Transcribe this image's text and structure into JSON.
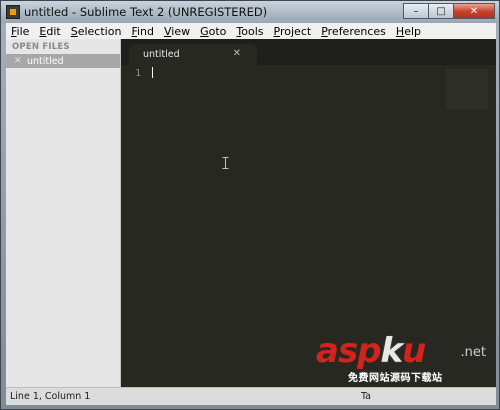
{
  "window": {
    "title": "untitled - Sublime Text 2 (UNREGISTERED)",
    "controls": [
      "–",
      "□",
      "✕"
    ]
  },
  "menu": [
    "File",
    "Edit",
    "Selection",
    "Find",
    "View",
    "Goto",
    "Tools",
    "Project",
    "Preferences",
    "Help"
  ],
  "sidebar": {
    "header": "OPEN FILES",
    "files": [
      {
        "name": "untitled",
        "close": "✕"
      }
    ]
  },
  "editor": {
    "tab": {
      "label": "untitled",
      "close": "✕"
    },
    "line_numbers": [
      "1"
    ]
  },
  "status": {
    "position": "Line 1, Column 1",
    "right": "Ta"
  },
  "watermark": {
    "main_a": "asp",
    "main_k": "k",
    "main_u": "u",
    "net": ".net",
    "sub": "免费网站源码下载站"
  },
  "colors": {
    "editor_bg": "#272822",
    "sidebar_bg": "#e6e6e6",
    "watermark_red": "#d2241c"
  }
}
